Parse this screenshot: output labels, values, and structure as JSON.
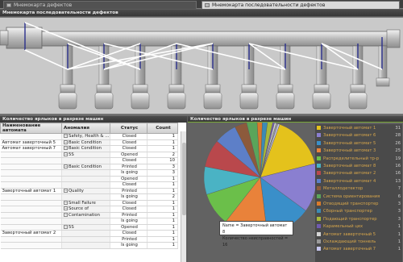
{
  "tabs": [
    {
      "label": "Мнемокарта дефектов"
    },
    {
      "label": "Мнемокарта последовательности дефектов"
    }
  ],
  "diagram_panel": {
    "title": "Мнемокарта последовательности дефектов"
  },
  "table_panel": {
    "title": "Количество ярлыков в разрезе машин",
    "headers": [
      "Наименование автомата",
      "Аномалия",
      "Статус",
      "Count"
    ],
    "rows": [
      {
        "machine": "",
        "anomaly": "Safety, Health & Env...",
        "status": "Closed",
        "count": "1"
      },
      {
        "machine": "Автомат заверточный 5",
        "anomaly": "Basic Condition",
        "status": "Closed",
        "count": "1"
      },
      {
        "machine": "Автомат заверточный 7",
        "anomaly": "Basic Condition",
        "status": "Closed",
        "count": "1"
      },
      {
        "machine": "",
        "anomaly": "5S",
        "status": "Opened",
        "count": "2"
      },
      {
        "machine": "",
        "anomaly": "",
        "status": "Closed",
        "count": "10"
      },
      {
        "machine": "",
        "anomaly": "Basic Condition",
        "status": "Printed",
        "count": "3"
      },
      {
        "machine": "",
        "anomaly": "",
        "status": "Is going",
        "count": "3"
      },
      {
        "machine": "",
        "anomaly": "",
        "status": "Opened",
        "count": "1"
      },
      {
        "machine": "",
        "anomaly": "",
        "status": "Closed",
        "count": "1"
      },
      {
        "machine": "Заверточный автомат 1",
        "anomaly": "Quality",
        "status": "Printed",
        "count": "1"
      },
      {
        "machine": "",
        "anomaly": "",
        "status": "Is going",
        "count": "2"
      },
      {
        "machine": "",
        "anomaly": "Small Failure",
        "status": "Closed",
        "count": "1"
      },
      {
        "machine": "",
        "anomaly": "Source of",
        "status": "Closed",
        "count": "1"
      },
      {
        "machine": "",
        "anomaly": "Contamination",
        "status": "Printed",
        "count": "1"
      },
      {
        "machine": "",
        "anomaly": "",
        "status": "Is going",
        "count": "1"
      },
      {
        "machine": "",
        "anomaly": "5S",
        "status": "Opened",
        "count": "1"
      },
      {
        "machine": "Заверточный автомат 2",
        "anomaly": "",
        "status": "Closed",
        "count": "1"
      },
      {
        "machine": "",
        "anomaly": "",
        "status": "Printed",
        "count": "1"
      },
      {
        "machine": "",
        "anomaly": "",
        "status": "Is going",
        "count": "1"
      }
    ]
  },
  "chart_panel": {
    "title": "Количество ярлыков в разрезе машин",
    "tooltip": {
      "line1": "Name = Заверточный автомат 8",
      "line2": "Количество неисправностей = 16"
    }
  },
  "chart_data": {
    "type": "pie",
    "title": "Количество ярлыков в разрезе машин",
    "categories": [
      "Заверточный автомат 1",
      "Заверточный автомат 6",
      "Заверточный автомат 5",
      "Заверточный автомат 3",
      "Распределительный тр-р",
      "Заверточный автомат 8",
      "Заверточный автомат 2",
      "Заверточный автомат 4",
      "Металлодетектор",
      "Система ориентирования",
      "Отводящий транспортер",
      "Сборный транспортер",
      "Подающий транспортер",
      "Карамельный цех",
      "Автомат заверточный 5",
      "Охлаждающий тоннель",
      "Автомат заверточный 7"
    ],
    "values": [
      31,
      28,
      26,
      25,
      19,
      16,
      16,
      13,
      7,
      6,
      3,
      3,
      3,
      1,
      1,
      1,
      1
    ],
    "colors": [
      "#e4c21c",
      "#8a7fd0",
      "#3a8fc9",
      "#e9823a",
      "#6bbf4a",
      "#4ab3c4",
      "#b9484c",
      "#5d7fc8",
      "#8c5a3c",
      "#5aa55a",
      "#d97b2a",
      "#3c8bb5",
      "#a8b83a",
      "#6f5bb0",
      "#d5d5d5",
      "#9a9a9a",
      "#c6c6ee"
    ]
  }
}
